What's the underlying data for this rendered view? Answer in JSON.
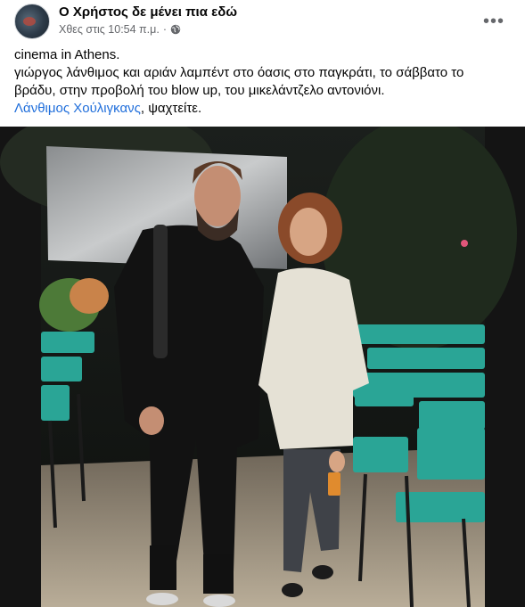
{
  "post": {
    "author": "Ο Χρήστος δε μένει πια εδώ",
    "timestamp": "Χθες στις 10:54 π.μ.",
    "separator": "·",
    "privacy_icon": "globe-icon",
    "more_icon": "more-options-icon",
    "text_lines": [
      "cinema in Athens.",
      "γιώργος λάνθιμος και αριάν λαμπέντ στο όασις στο παγκράτι, το σάββατο το",
      "βράδυ, στην προβολή του blow up, του μικελάντζελο αντονιόνι."
    ],
    "mention": "Λάνθιμος Χούλιγκανς",
    "mention_suffix": ", ψαχτείτε.",
    "colors": {
      "link": "#216fdb",
      "secondary_text": "#65676b",
      "chair_green": "#2aa596"
    }
  }
}
